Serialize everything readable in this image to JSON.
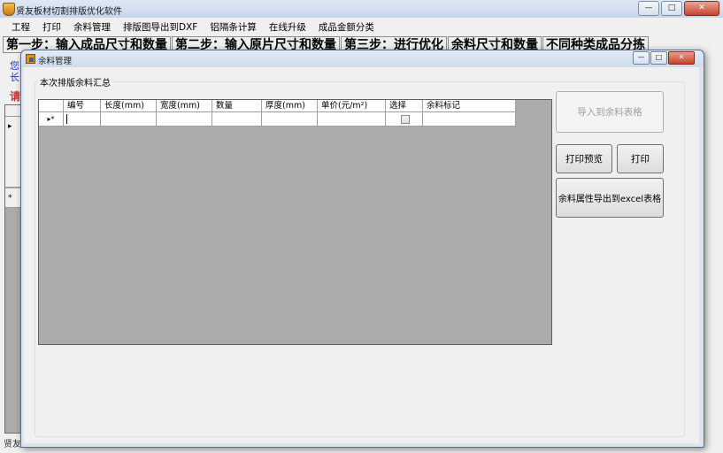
{
  "main_window": {
    "title": "贤友板材切割排版优化软件",
    "controls": {
      "minimize": "—",
      "maximize": "□",
      "close": "✕"
    },
    "menu": [
      "工程",
      "打印",
      "余料管理",
      "排版图导出到DXF",
      "铝隔条计算",
      "在线升级",
      "成品金额分类"
    ],
    "steps": [
      "第一步：输入成品尺寸和数量",
      "第二步：输入原片尺寸和数量",
      "第三步：进行优化",
      "余料尺寸和数量",
      "不同种类成品分拣"
    ],
    "left_fragments": {
      "line1": "您",
      "line2": "长",
      "prompt": "请"
    },
    "grid_markers": {
      "current_row": "▸",
      "new_row": "*"
    },
    "status": "贤友"
  },
  "dialog": {
    "title": "余料管理",
    "controls": {
      "minimize": "—",
      "maximize": "□",
      "close": "✕"
    },
    "group_label": "本次排版余料汇总",
    "columns": [
      "编号",
      "长度(mm)",
      "宽度(mm)",
      "数量",
      "厚度(mm)",
      "单价(元/m²)",
      "选择",
      "余料标记"
    ],
    "row_marker": "▸*",
    "buttons": {
      "import": "导入到余料表格",
      "print_preview": "打印预览",
      "print": "打印",
      "export_excel": "余料属性导出到excel表格"
    }
  }
}
